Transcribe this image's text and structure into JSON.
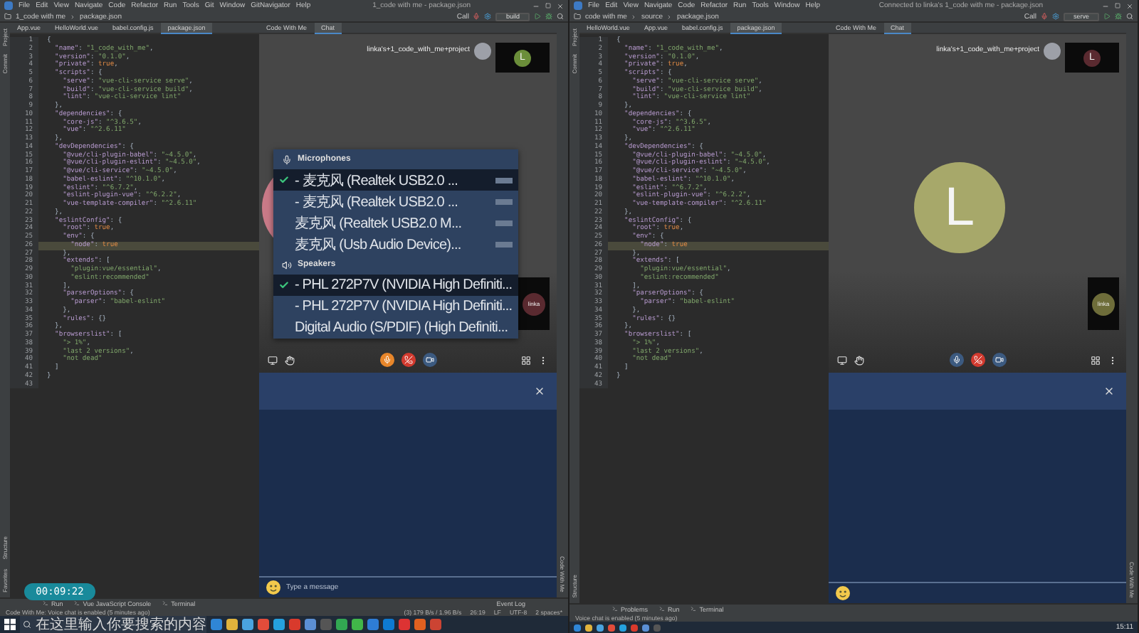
{
  "screens": [
    {
      "kind": "host",
      "window_title": "1_code with me - package.json",
      "menu": [
        "File",
        "Edit",
        "View",
        "Navigate",
        "Code",
        "Refactor",
        "Run",
        "Tools",
        "Git",
        "Window",
        "GitNavigator",
        "Help"
      ],
      "breadcrumbs": [
        "1_code with me",
        "package.json"
      ],
      "call_label": "Call",
      "run_config": "build",
      "editor_tabs": [
        {
          "label": "App.vue",
          "selected": false
        },
        {
          "label": "HelloWorld.vue",
          "selected": false
        },
        {
          "label": "babel.config.js",
          "selected": false
        },
        {
          "label": "package.json",
          "selected": true
        }
      ],
      "left_strip": [
        "Project",
        "Commit"
      ],
      "left_strip_bottom": [
        "Structure",
        "Favorites"
      ],
      "right_strip": [
        "Code With Me"
      ],
      "code_lines": [
        {
          "number": "1",
          "text": "{",
          "selected": false
        },
        {
          "number": "2",
          "text": "  \"name\": \"1_code_with_me\",",
          "selected": false
        },
        {
          "number": "3",
          "text": "  \"version\": \"0.1.0\",",
          "selected": false
        },
        {
          "number": "4",
          "text": "  \"private\": true,",
          "selected": false
        },
        {
          "number": "5",
          "text": "  \"scripts\": {",
          "selected": false
        },
        {
          "number": "6",
          "text": "    \"serve\": \"vue-cli-service serve\",",
          "selected": false
        },
        {
          "number": "7",
          "text": "    \"build\": \"vue-cli-service build\",",
          "selected": false
        },
        {
          "number": "8",
          "text": "    \"lint\": \"vue-cli-service lint\"",
          "selected": false
        },
        {
          "number": "9",
          "text": "  },",
          "selected": false
        },
        {
          "number": "10",
          "text": "  \"dependencies\": {",
          "selected": false
        },
        {
          "number": "11",
          "text": "    \"core-js\": \"^3.6.5\",",
          "selected": false
        },
        {
          "number": "12",
          "text": "    \"vue\": \"^2.6.11\"",
          "selected": false
        },
        {
          "number": "13",
          "text": "  },",
          "selected": false
        },
        {
          "number": "14",
          "text": "  \"devDependencies\": {",
          "selected": false
        },
        {
          "number": "15",
          "text": "    \"@vue/cli-plugin-babel\": \"~4.5.0\",",
          "selected": false
        },
        {
          "number": "16",
          "text": "    \"@vue/cli-plugin-eslint\": \"~4.5.0\",",
          "selected": false
        },
        {
          "number": "17",
          "text": "    \"@vue/cli-service\": \"~4.5.0\",",
          "selected": false
        },
        {
          "number": "18",
          "text": "    \"babel-eslint\": \"^10.1.0\",",
          "selected": false
        },
        {
          "number": "19",
          "text": "    \"eslint\": \"^6.7.2\",",
          "selected": false
        },
        {
          "number": "20",
          "text": "    \"eslint-plugin-vue\": \"^6.2.2\",",
          "selected": false
        },
        {
          "number": "21",
          "text": "    \"vue-template-compiler\": \"^2.6.11\"",
          "selected": false
        },
        {
          "number": "22",
          "text": "  },",
          "selected": false
        },
        {
          "number": "23",
          "text": "  \"eslintConfig\": {",
          "selected": false
        },
        {
          "number": "24",
          "text": "    \"root\": true,",
          "selected": false
        },
        {
          "number": "25",
          "text": "    \"env\": {",
          "selected": false
        },
        {
          "number": "26",
          "text": "      \"node\": true",
          "selected": true
        },
        {
          "number": "27",
          "text": "    },",
          "selected": false
        },
        {
          "number": "28",
          "text": "    \"extends\": [",
          "selected": false
        },
        {
          "number": "29",
          "text": "      \"plugin:vue/essential\",",
          "selected": false
        },
        {
          "number": "30",
          "text": "      \"eslint:recommended\"",
          "selected": false
        },
        {
          "number": "31",
          "text": "    ],",
          "selected": false
        },
        {
          "number": "32",
          "text": "    \"parserOptions\": {",
          "selected": false
        },
        {
          "number": "33",
          "text": "      \"parser\": \"babel-eslint\"",
          "selected": false
        },
        {
          "number": "34",
          "text": "    },",
          "selected": false
        },
        {
          "number": "35",
          "text": "    \"rules\": {}",
          "selected": false
        },
        {
          "number": "36",
          "text": "  },",
          "selected": false
        },
        {
          "number": "37",
          "text": "  \"browserslist\": [",
          "selected": false
        },
        {
          "number": "38",
          "text": "    \"> 1%\",",
          "selected": false
        },
        {
          "number": "39",
          "text": "    \"last 2 versions\",",
          "selected": false
        },
        {
          "number": "40",
          "text": "    \"not dead\"",
          "selected": false
        },
        {
          "number": "41",
          "text": "  ]",
          "selected": false
        },
        {
          "number": "42",
          "text": "}",
          "selected": false
        },
        {
          "number": "43",
          "selected": false
        }
      ],
      "panel_tabs": [
        {
          "label": "Code With Me",
          "selected": false
        },
        {
          "label": "Chat",
          "selected": true
        }
      ],
      "call": {
        "title": "linka's+1_code_with_me+project",
        "thumb_letter": "L",
        "thumb2_label": "linka"
      },
      "audio_menu": [
        {
          "kind": "microphones",
          "title": "Microphones",
          "items": [
            {
              "label": "- 麦克风 (Realtek USB2.0 ...",
              "selected": true
            },
            {
              "label": "- 麦克风 (Realtek USB2.0 ...",
              "selected": false
            },
            {
              "label": "麦克风 (Realtek USB2.0 M...",
              "selected": false
            },
            {
              "label": "麦克风 (Usb Audio Device)...",
              "selected": false
            }
          ]
        },
        {
          "kind": "speakers",
          "title": "Speakers",
          "items": [
            {
              "label": "- PHL 272P7V (NVIDIA High Definiti...",
              "selected": true
            },
            {
              "label": "- PHL 272P7V (NVIDIA High Definiti...",
              "selected": false
            },
            {
              "label": "Digital Audio (S/PDIF) (High Definiti...",
              "selected": false
            }
          ]
        }
      ],
      "chat": {
        "placeholder": "Type a message"
      },
      "tool_tabs": [
        "Run",
        "Vue JavaScript Console",
        "Terminal"
      ],
      "event_log": "Event Log",
      "status_message": "Code With Me: Voice chat is enabled (5 minutes ago)",
      "status_info": [
        "(3) 179 B/s / 1.96 B/s",
        "26:19",
        "LF",
        "UTF-8",
        "2 spaces*"
      ],
      "recording_timer": "00:09:22",
      "taskbar": {
        "search_placeholder": "在这里输入你要搜索的内容"
      }
    },
    {
      "kind": "guest",
      "window_title": "Connected to linka's 1_code with me - package.json",
      "menu": [
        "File",
        "Edit",
        "View",
        "Navigate",
        "Code",
        "Refactor",
        "Run",
        "Tools",
        "Window",
        "Help"
      ],
      "breadcrumbs": [
        "code with me",
        "source",
        "package.json"
      ],
      "call_label": "Call",
      "run_config": "serve",
      "editor_tabs": [
        {
          "label": "HelloWorld.vue",
          "selected": false
        },
        {
          "label": "App.vue",
          "selected": false
        },
        {
          "label": "babel.config.js",
          "selected": false
        },
        {
          "label": "package.json",
          "selected": true
        }
      ],
      "left_strip": [
        "Project",
        "Commit"
      ],
      "left_strip_bottom": [
        "Structure"
      ],
      "right_strip": [
        "Code With Me"
      ],
      "code_lines": [
        {
          "number": "1",
          "text": "{",
          "selected": false
        },
        {
          "number": "2",
          "text": "  \"name\": \"1_code_with_me\",",
          "selected": false
        },
        {
          "number": "3",
          "text": "  \"version\": \"0.1.0\",",
          "selected": false
        },
        {
          "number": "4",
          "text": "  \"private\": true,",
          "selected": false
        },
        {
          "number": "5",
          "text": "  \"scripts\": {",
          "selected": false
        },
        {
          "number": "6",
          "text": "    \"serve\": \"vue-cli-service serve\",",
          "selected": false
        },
        {
          "number": "7",
          "text": "    \"build\": \"vue-cli-service build\",",
          "selected": false
        },
        {
          "number": "8",
          "text": "    \"lint\": \"vue-cli-service lint\"",
          "selected": false
        },
        {
          "number": "9",
          "text": "  },",
          "selected": false
        },
        {
          "number": "10",
          "text": "  \"dependencies\": {",
          "selected": false
        },
        {
          "number": "11",
          "text": "    \"core-js\": \"^3.6.5\",",
          "selected": false
        },
        {
          "number": "12",
          "text": "    \"vue\": \"^2.6.11\"",
          "selected": false
        },
        {
          "number": "13",
          "text": "  },",
          "selected": false
        },
        {
          "number": "14",
          "text": "  \"devDependencies\": {",
          "selected": false
        },
        {
          "number": "15",
          "text": "    \"@vue/cli-plugin-babel\": \"~4.5.0\",",
          "selected": false
        },
        {
          "number": "16",
          "text": "    \"@vue/cli-plugin-eslint\": \"~4.5.0\",",
          "selected": false
        },
        {
          "number": "17",
          "text": "    \"@vue/cli-service\": \"~4.5.0\",",
          "selected": false
        },
        {
          "number": "18",
          "text": "    \"babel-eslint\": \"^10.1.0\",",
          "selected": false
        },
        {
          "number": "19",
          "text": "    \"eslint\": \"^6.7.2\",",
          "selected": false
        },
        {
          "number": "20",
          "text": "    \"eslint-plugin-vue\": \"^6.2.2\",",
          "selected": false
        },
        {
          "number": "21",
          "text": "    \"vue-template-compiler\": \"^2.6.11\"",
          "selected": false
        },
        {
          "number": "22",
          "text": "  },",
          "selected": false
        },
        {
          "number": "23",
          "text": "  \"eslintConfig\": {",
          "selected": false
        },
        {
          "number": "24",
          "text": "    \"root\": true,",
          "selected": false
        },
        {
          "number": "25",
          "text": "    \"env\": {",
          "selected": false
        },
        {
          "number": "26",
          "text": "      \"node\": true",
          "selected": true
        },
        {
          "number": "27",
          "text": "    },",
          "selected": false
        },
        {
          "number": "28",
          "text": "    \"extends\": [",
          "selected": false
        },
        {
          "number": "29",
          "text": "      \"plugin:vue/essential\",",
          "selected": false
        },
        {
          "number": "30",
          "text": "      \"eslint:recommended\"",
          "selected": false
        },
        {
          "number": "31",
          "text": "    ],",
          "selected": false
        },
        {
          "number": "32",
          "text": "    \"parserOptions\": {",
          "selected": false
        },
        {
          "number": "33",
          "text": "      \"parser\": \"babel-eslint\"",
          "selected": false
        },
        {
          "number": "34",
          "text": "    },",
          "selected": false
        },
        {
          "number": "35",
          "text": "    \"rules\": {}",
          "selected": false
        },
        {
          "number": "36",
          "text": "  },",
          "selected": false
        },
        {
          "number": "37",
          "text": "  \"browserslist\": [",
          "selected": false
        },
        {
          "number": "38",
          "text": "    \"> 1%\",",
          "selected": false
        },
        {
          "number": "39",
          "text": "    \"last 2 versions\",",
          "selected": false
        },
        {
          "number": "40",
          "text": "    \"not dead\"",
          "selected": false
        },
        {
          "number": "41",
          "text": "  ]",
          "selected": false
        },
        {
          "number": "42",
          "text": "}",
          "selected": false
        },
        {
          "number": "43",
          "selected": false
        }
      ],
      "panel_tabs": [
        {
          "label": "Code With Me",
          "selected": false
        },
        {
          "label": "Chat",
          "selected": true
        }
      ],
      "call": {
        "title": "linka's+1_code_with_me+project",
        "thumb_letter": "L",
        "big_letter": "L",
        "thumb2_label": "linka"
      },
      "tool_tabs": [
        "Problems",
        "Run",
        "Terminal"
      ],
      "status_message": "Voice chat is enabled (5 minutes ago)",
      "taskbar": {
        "time": "15:11"
      }
    }
  ]
}
